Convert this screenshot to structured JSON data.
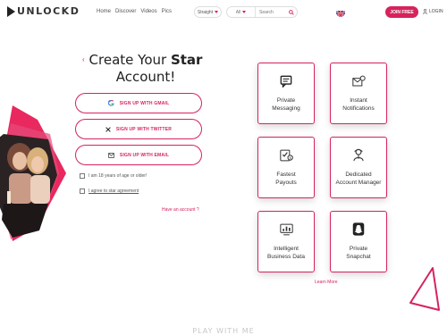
{
  "header": {
    "logo_text": "UNLOCKD",
    "nav": [
      "Home",
      "Discover",
      "Videos",
      "Pics"
    ],
    "orientation_select": "Straight",
    "search_category": "All",
    "search_placeholder": "Search",
    "join_label": "JOIN FREE",
    "login_label": "LOGIN"
  },
  "title": {
    "line1_regular": "Create Your ",
    "line1_bold": "Star",
    "line2": "Account!"
  },
  "signup": {
    "gmail": "SIGN UP WITH GMAIL",
    "twitter": "SIGN UP WITH TWITTER",
    "email": "SIGN UP WITH EMAIL"
  },
  "checks": {
    "age": "I am 18 years of age or older!",
    "agreement": "I agree to star agreement"
  },
  "have_account": "Have an account ?",
  "features": [
    {
      "line1": "Private",
      "line2": "Messaging",
      "icon": "chat-icon"
    },
    {
      "line1": "Instant",
      "line2": "Notifications",
      "icon": "envelope-bell-icon"
    },
    {
      "line1": "Fastest",
      "line2": "Payouts",
      "icon": "money-check-icon"
    },
    {
      "line1": "Dedicated",
      "line2": "Account Manager",
      "icon": "manager-icon"
    },
    {
      "line1": "Intelligent",
      "line2": "Business Data",
      "icon": "analytics-icon"
    },
    {
      "line1": "Private",
      "line2": "Snapchat",
      "icon": "snapchat-icon"
    }
  ],
  "learn_more": "Learn More",
  "footer_heading": "PLAY WITH ME",
  "colors": {
    "accent": "#d6235c",
    "text": "#222222"
  }
}
